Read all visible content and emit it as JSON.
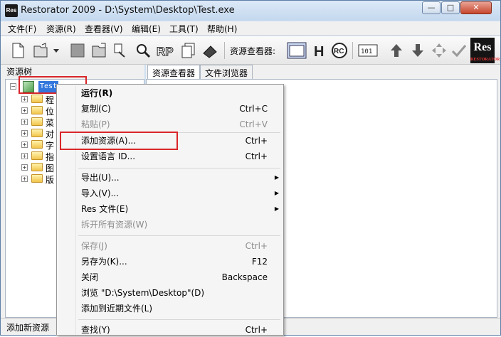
{
  "window": {
    "title": "Restorator 2009 - D:\\System\\Desktop\\Test.exe",
    "app_icon_text": "Res"
  },
  "menubar": [
    "文件(F)",
    "资源(R)",
    "查看器(V)",
    "编辑(E)",
    "工具(T)",
    "帮助(H)"
  ],
  "toolbar": {
    "viewer_label": "资源查看器:",
    "logo_text": "Res",
    "logo_subtext": "RESTORATOR"
  },
  "left_pane": {
    "header": "资源树",
    "root_label": "Test",
    "nodes": [
      "程",
      "位",
      "菜",
      "对",
      "字",
      "指",
      "图",
      "版"
    ]
  },
  "right_pane": {
    "tabs": [
      "资源查看器",
      "文件浏览器"
    ]
  },
  "status": {
    "text": "添加新资源"
  },
  "context_menu": {
    "items": [
      {
        "label": "运行(R)",
        "shortcut": "",
        "disabled": false,
        "submenu": false
      },
      {
        "label": "复制(C)",
        "shortcut": "Ctrl+C",
        "disabled": false,
        "submenu": false
      },
      {
        "label": "粘贴(P)",
        "shortcut": "Ctrl+V",
        "disabled": true,
        "submenu": false
      },
      {
        "label": "添加资源(A)...",
        "shortcut": "Ctrl+",
        "disabled": false,
        "submenu": false
      },
      {
        "label": "设置语言 ID...",
        "shortcut": "Ctrl+",
        "disabled": false,
        "submenu": false
      },
      {
        "label": "导出(U)...",
        "shortcut": "",
        "disabled": false,
        "submenu": true
      },
      {
        "label": "导入(V)...",
        "shortcut": "",
        "disabled": false,
        "submenu": true
      },
      {
        "label": "Res 文件(E)",
        "shortcut": "",
        "disabled": false,
        "submenu": true
      },
      {
        "label": "拆开所有资源(W)",
        "shortcut": "",
        "disabled": true,
        "submenu": false
      },
      {
        "label": "保存(J)",
        "shortcut": "Ctrl+",
        "disabled": true,
        "submenu": false
      },
      {
        "label": "另存为(K)...",
        "shortcut": "F12",
        "disabled": false,
        "submenu": false
      },
      {
        "label": "关闭",
        "shortcut": "Backspace",
        "disabled": false,
        "submenu": false
      },
      {
        "label": "浏览 \"D:\\System\\Desktop\"(D)",
        "shortcut": "",
        "disabled": false,
        "submenu": false
      },
      {
        "label": "添加到近期文件(L)",
        "shortcut": "",
        "disabled": false,
        "submenu": false
      },
      {
        "label": "查找(Y)",
        "shortcut": "Ctrl+",
        "disabled": false,
        "submenu": false
      }
    ]
  },
  "colors": {
    "highlight_border": "#d9262a",
    "selection": "#3377dd"
  }
}
